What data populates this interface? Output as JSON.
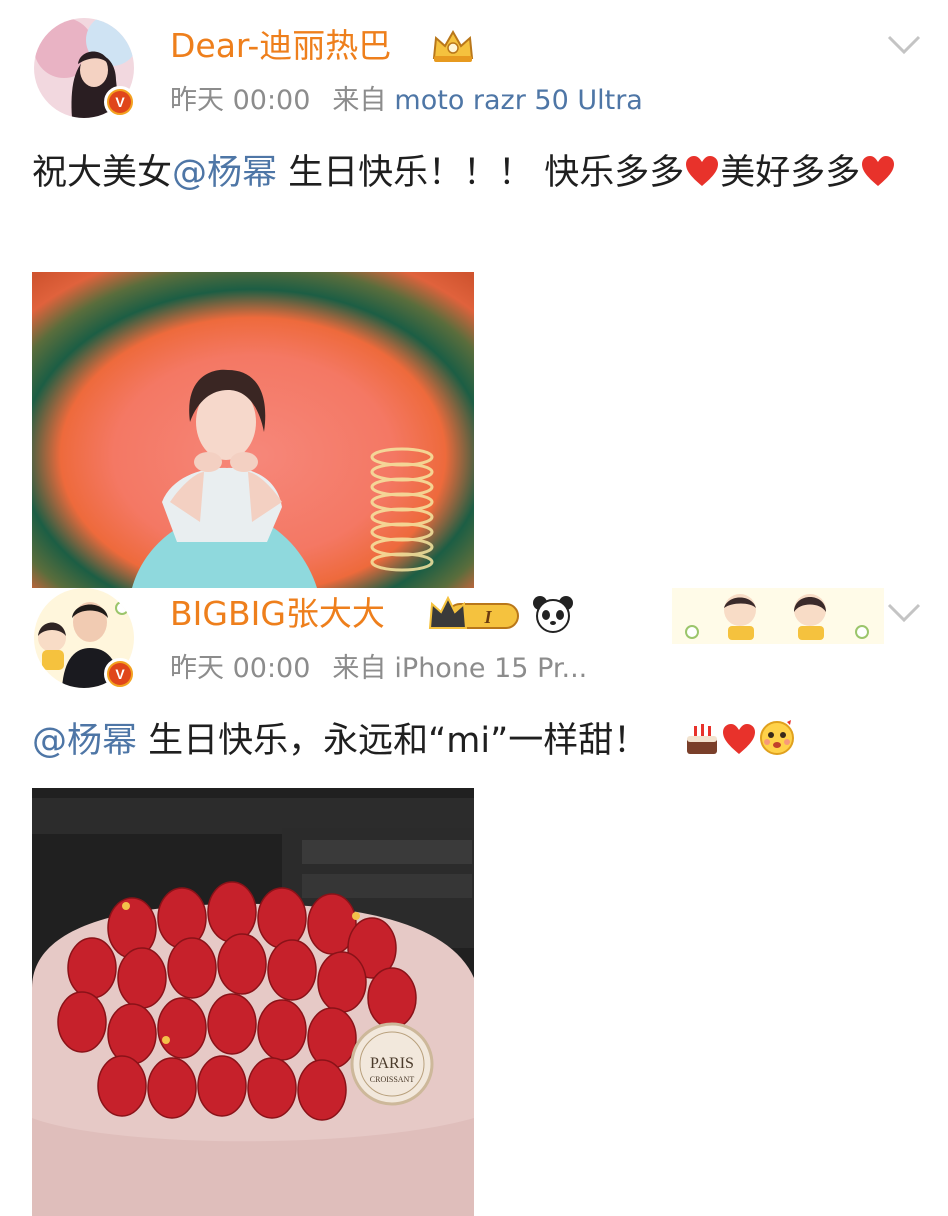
{
  "posts": [
    {
      "username": "Dear-迪丽热巴",
      "time": "昨天 00:00",
      "source_prefix": "来自",
      "source": "moto razr 50 Ultra",
      "text_1": "祝大美女",
      "mention": "@杨幂",
      "text_2": " 生日快乐！！！ 快乐多多",
      "text_3": "美好多多",
      "image": "photo of woman resting chin on hands against colorful circular backdrop"
    },
    {
      "username": "BIGBIG张大大",
      "time": "昨天 00:00",
      "source_prefix": "来自",
      "source": "iPhone 15 Pr...",
      "mention": "@杨幂",
      "text_1": " 生日快乐，永远和“mi”一样甜！",
      "image": "strawberry birthday cake with PARIS CROISSANT plaque",
      "cake_plaque_line1": "PARIS",
      "cake_plaque_line2": "CROISSANT",
      "rank_badge": "I"
    }
  ],
  "icons": {
    "verified": "V",
    "crown": "crown-icon",
    "panda": "panda-icon",
    "chevron": "chevron-down-icon",
    "heart": "heart-icon",
    "cake": "cake-icon",
    "emoji": "blush-emoji-icon"
  },
  "colors": {
    "username": "#ee7f1c",
    "mention": "#4e76a6",
    "meta": "#8c8c8c",
    "heart": "#e8322b"
  }
}
